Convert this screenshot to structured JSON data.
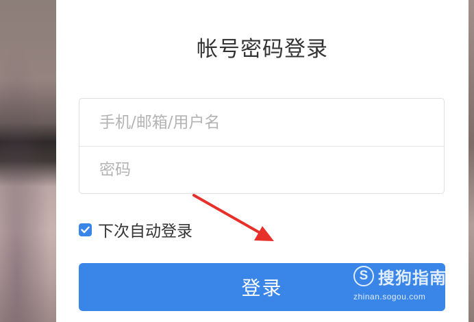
{
  "login": {
    "title": "帐号密码登录",
    "username_placeholder": "手机/邮箱/用户名",
    "password_placeholder": "密码",
    "remember_label": "下次自动登录",
    "remember_checked": true,
    "submit_label": "登录"
  },
  "watermark": {
    "logo_letter": "S",
    "brand": "搜狗指南",
    "url": "zhinan.sogou.com"
  },
  "colors": {
    "accent": "#3a86e8",
    "annotation_arrow": "#e8302a",
    "text": "#333333",
    "placeholder": "#b3b3b3"
  },
  "icons": {
    "checkbox": "checkmark-icon",
    "annotation": "red-arrow-icon"
  }
}
